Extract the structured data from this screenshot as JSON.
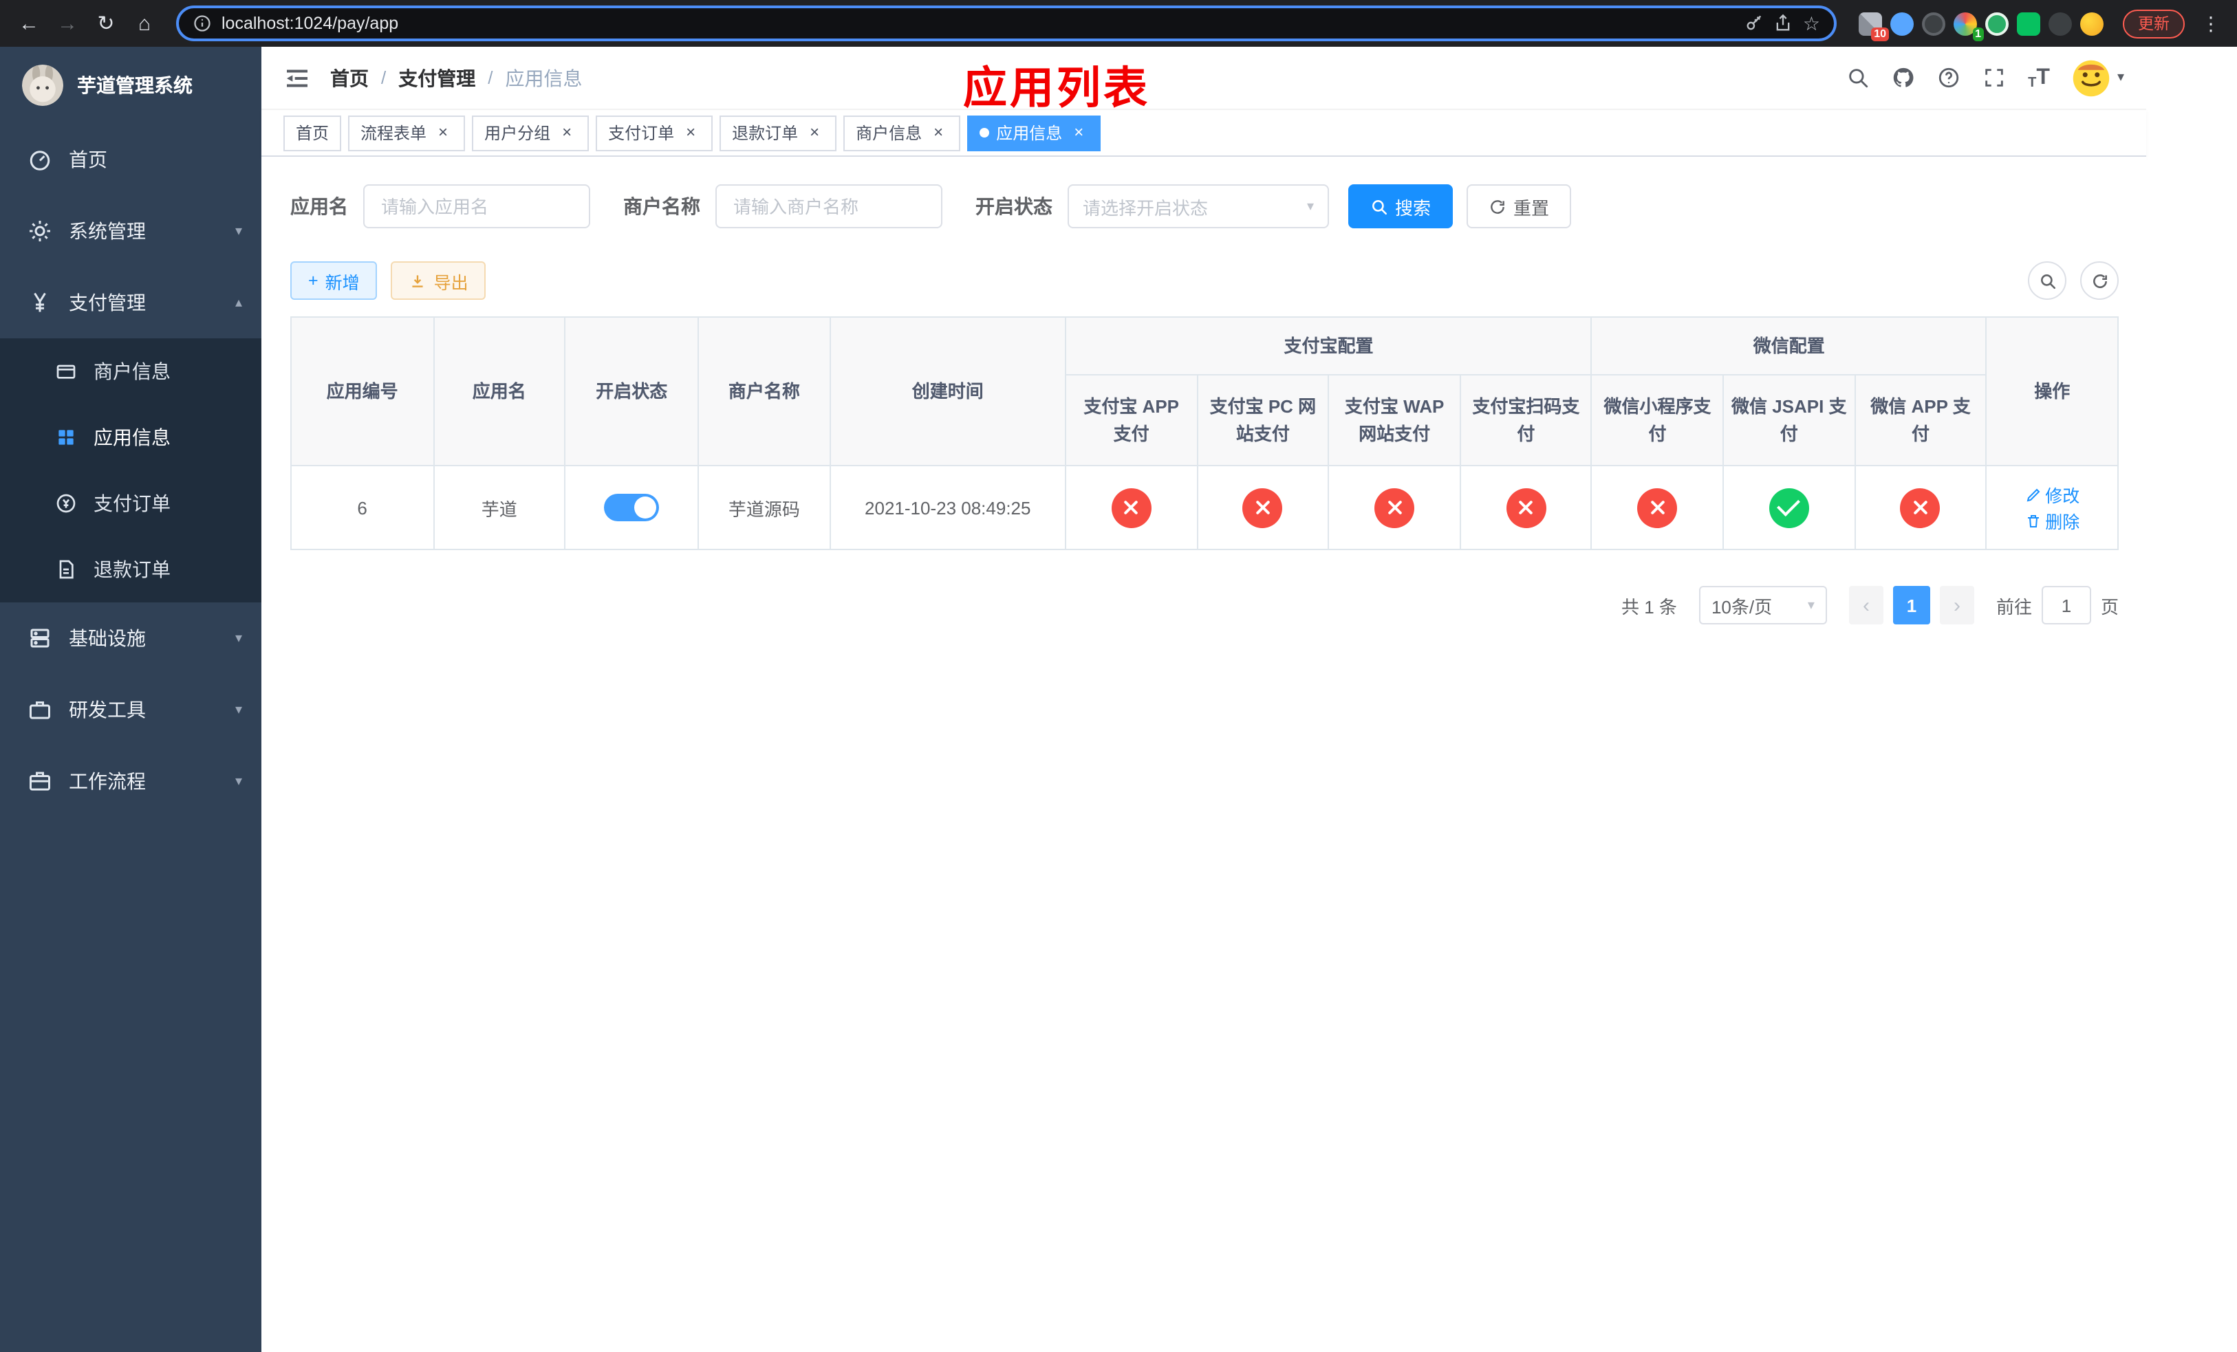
{
  "colors": {
    "sidebar_bg": "#304156",
    "submenu_bg": "#1f2d3d",
    "primary_blue": "#1890ff",
    "active_blue": "#409eff",
    "danger_red": "#f74c42",
    "success_green": "#13ce66",
    "page_title_red": "#f20000",
    "warning_orange": "#e6a23c"
  },
  "icons": {
    "back": "←",
    "forward": "→",
    "reload": "↻",
    "home": "⌂",
    "star": "☆",
    "dots": "⋮",
    "close": "×",
    "chevron_down": "▾",
    "chevron_up": "▴",
    "plus": "+",
    "prev": "‹",
    "next": "›",
    "breadcrumb_sep": "/"
  },
  "browser": {
    "url": "localhost:1024/pay/app",
    "update_label": "更新",
    "badge_red": "10",
    "badge_green": "1"
  },
  "app_title": "芋道管理系统",
  "sidebar": {
    "items": [
      {
        "label": "首页"
      },
      {
        "label": "系统管理"
      },
      {
        "label": "支付管理"
      },
      {
        "label": "基础设施"
      },
      {
        "label": "研发工具"
      },
      {
        "label": "工作流程"
      }
    ],
    "payment_children": [
      {
        "label": "商户信息"
      },
      {
        "label": "应用信息",
        "active": true
      },
      {
        "label": "支付订单"
      },
      {
        "label": "退款订单"
      }
    ]
  },
  "header": {
    "breadcrumb": [
      "首页",
      "支付管理",
      "应用信息"
    ],
    "page_title": "应用列表"
  },
  "tabs": [
    {
      "label": "首页",
      "closable": false,
      "active": false
    },
    {
      "label": "流程表单",
      "closable": true,
      "active": false
    },
    {
      "label": "用户分组",
      "closable": true,
      "active": false
    },
    {
      "label": "支付订单",
      "closable": true,
      "active": false
    },
    {
      "label": "退款订单",
      "closable": true,
      "active": false
    },
    {
      "label": "商户信息",
      "closable": true,
      "active": false
    },
    {
      "label": "应用信息",
      "closable": true,
      "active": true
    }
  ],
  "filters": {
    "app_name_label": "应用名",
    "app_name_placeholder": "请输入应用名",
    "merchant_label": "商户名称",
    "merchant_placeholder": "请输入商户名称",
    "status_label": "开启状态",
    "status_placeholder": "请选择开启状态",
    "search_label": "搜索",
    "reset_label": "重置"
  },
  "toolbar": {
    "add_label": "新增",
    "export_label": "导出"
  },
  "table": {
    "groups": {
      "alipay": "支付宝配置",
      "wechat": "微信配置"
    },
    "columns": [
      "应用编号",
      "应用名",
      "开启状态",
      "商户名称",
      "创建时间",
      "支付宝 APP 支付",
      "支付宝 PC 网站支付",
      "支付宝 WAP 网站支付",
      "支付宝扫码支付",
      "微信小程序支付",
      "微信 JSAPI 支付",
      "微信 APP 支付",
      "操作"
    ],
    "row": {
      "id": "6",
      "name": "芋道",
      "enabled": true,
      "merchant": "芋道源码",
      "created_at": "2021-10-23 08:49:25",
      "configs": {
        "alipay_app": false,
        "alipay_pc": false,
        "alipay_wap": false,
        "alipay_qr": false,
        "wechat_mini": false,
        "wechat_jsapi": true,
        "wechat_app": false
      },
      "edit_label": "修改",
      "delete_label": "删除"
    }
  },
  "pagination": {
    "total": "共 1 条",
    "page_size": "10条/页",
    "page": "1",
    "goto_label": "前往",
    "goto_value": "1",
    "unit": "页"
  }
}
